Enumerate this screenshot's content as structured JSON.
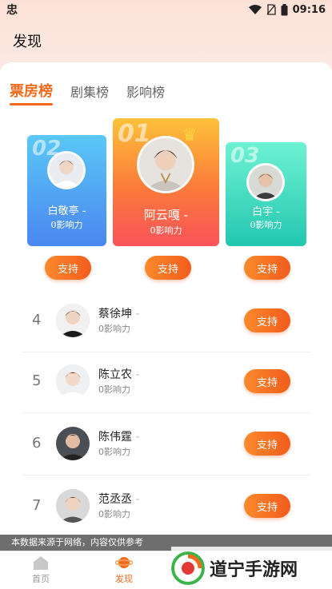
{
  "statusbar": {
    "app_glyph": "忠",
    "time": "09:16"
  },
  "header": {
    "title": "发现"
  },
  "tabs": [
    {
      "label": "票房榜",
      "active": true
    },
    {
      "label": "剧集榜",
      "active": false
    },
    {
      "label": "影响榜",
      "active": false
    }
  ],
  "podium": [
    {
      "rank": "01",
      "name": "阿云嘎",
      "influence": "0影响力"
    },
    {
      "rank": "02",
      "name": "白敬亭",
      "influence": "0影响力"
    },
    {
      "rank": "03",
      "name": "白宇",
      "influence": "0影响力"
    }
  ],
  "support_label": "支持",
  "rows": [
    {
      "rank": "4",
      "name": "蔡徐坤",
      "influence": "0影响力"
    },
    {
      "rank": "5",
      "name": "陈立农",
      "influence": "0影响力"
    },
    {
      "rank": "6",
      "name": "陈伟霆",
      "influence": "0影响力"
    },
    {
      "rank": "7",
      "name": "范丞丞",
      "influence": "0影响力"
    }
  ],
  "notice": "本数据来源于网络，内容仅供参考",
  "nav": {
    "home": "首页",
    "discover": "发现"
  },
  "watermark": "道宁手游网",
  "colors": {
    "accent": "#f26a1b"
  }
}
